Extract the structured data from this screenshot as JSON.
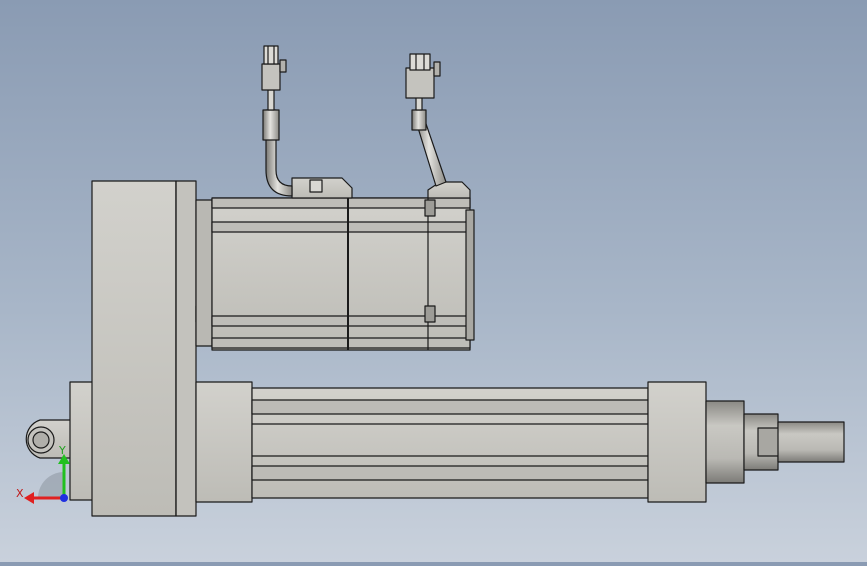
{
  "viewport": {
    "background_top": "#8a9bb3",
    "background_bottom": "#c9d1dc"
  },
  "part_color": "#c8c7c2",
  "edge_color": "#1a1a1a",
  "triad": {
    "x_label": "X",
    "y_label": "Y",
    "x_color": "#e02020",
    "y_color": "#20c020",
    "z_color": "#2030e0"
  }
}
